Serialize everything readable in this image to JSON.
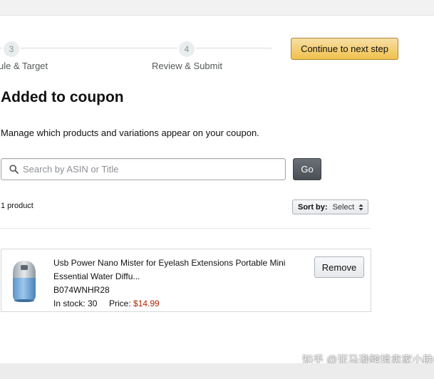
{
  "stepper": {
    "steps": [
      {
        "number": "3",
        "label": "ule & Target"
      },
      {
        "number": "4",
        "label": "Review & Submit"
      }
    ],
    "continue_label": "Continue to next step"
  },
  "main": {
    "title": "Added to coupon",
    "description": "Manage which products and variations appear on your coupon."
  },
  "search": {
    "placeholder": "Search by ASIN or Title",
    "value": "",
    "go_label": "Go"
  },
  "results": {
    "count_text": "1 product",
    "sort_label": "Sort by:",
    "sort_value": "Select"
  },
  "products": [
    {
      "title": "Usb Power Nano Mister for Eyelash Extensions Portable Mini Essential Water Diffu...",
      "asin": "B074WNHR28",
      "stock_text": "In stock: 30",
      "price_label": "Price: ",
      "price_value": "$14.99",
      "remove_label": "Remove",
      "image_icon": "product-image-mister"
    }
  ],
  "watermark": "知乎 @亚马逊跨境卖家小助手",
  "colors": {
    "primary_button": "#f0c14b",
    "price": "#b12704",
    "go_button": "#4a4f55"
  }
}
